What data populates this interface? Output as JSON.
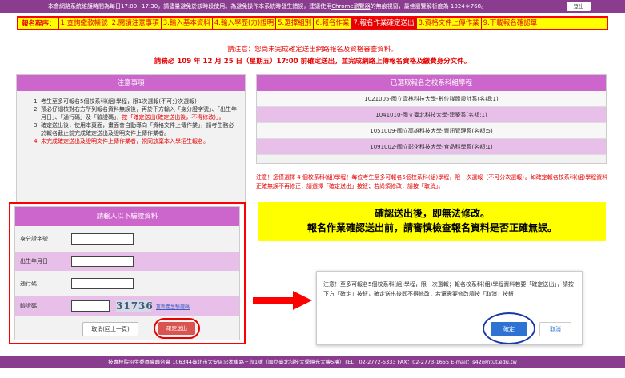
{
  "topbar": {
    "notice_part1": "本會網路系統維護時間為每日17:00~17:30，請儘量避免於該時段使用。為避免操作本系統時發生錯誤，建議使用",
    "notice_link": "Chrome瀏覽器",
    "notice_part2": "的無痕視窗，最佳瀏覽解析度為 1024＊768。",
    "logout_label": "登出"
  },
  "steps": {
    "label": "報名程序：",
    "items": [
      "1.查詢繳款帳號",
      "2.閱讀注意事項",
      "3.輸入基本資料",
      "4.輸入學歷(力)證明",
      "5.選擇組別",
      "6.報名作業",
      "7.報名作業確定送出",
      "8.資格文件上傳作業",
      "9.下載報名確認單"
    ],
    "active_index": 6
  },
  "warnings": {
    "line1": "請注意：您尚未完成確定送出網路報名及資格審查資料。",
    "line2": "請務必 109 年 12 月 25 日（星期五）17:00 前確定送出，並完成網路上傳報名資格及繳費身分文件。"
  },
  "notes": {
    "title": "注意事項",
    "items": [
      "考生至多可報名5個校系科(組)學程，限1次選報(不可分次選報)",
      "預必仔細核對右方所列報名資料無誤後，再於下方輸入「身分證字號」、「出生年月日」、「通行碼」及「驗證碼」，",
      "確定送出後，使用本頁面，畫面會自動導向「資格文件上傳作業」，請考生務必於報名截止前完成確定送出及證明文件上傳作業者。",
      "未完成確定送出及證明文件上傳作業者，視同放棄本入學招生報名。"
    ],
    "item2_red": "按「確定送出(確定送出後，不得修改)」。"
  },
  "schools": {
    "title": "已選取報名之校系科組學程",
    "rows": [
      "1021005-國立雲林科技大學-數位媒體設計系(名額:1)",
      "1041010-國立臺北科技大學-建築系(名額:1)",
      "1051009-國立高雄科技大學-資訊管理系(名額:5)",
      "1091002-國立彰化科技大學-食品科學系(名額:1)"
    ]
  },
  "bignote": "注意！您僅選擇 4 個校系科(組)學程！每位考生至多可報名5個校系科(組)學程，限一次選報（不可分次選報）。如確定報名校系科(組)學程資料正確無誤不再修正，請選擇「確定送出」按鈕；若尚須修改，請按「取消」。",
  "yellowbox": {
    "line1": "確認送出後，即無法修改。",
    "line2": "報名作業確認送出前，請審慎檢查報名資料是否正確無誤。"
  },
  "verify": {
    "title": "請輸入以下驗證資料",
    "fields": [
      {
        "label": "身分證字號"
      },
      {
        "label": "出生年月日"
      },
      {
        "label": "通行碼"
      },
      {
        "label": "驗證碼"
      }
    ],
    "captcha": "31736",
    "refresh_label": "重新產生驗證碼",
    "back_label": "取消(回上一頁)",
    "submit_label": "確定送出"
  },
  "dialog": {
    "message": "注意！至多可報名5個校系科(組)學程，限一次選報；報名校系科(組)學程資料若要「確定送出」，請按下方「確定」按鈕，確定送出後即不得修改，若還需要修改請按「取消」按鈕",
    "ok_label": "確定",
    "cancel_label": "取消"
  },
  "footer": "技專校院招生委員會聯合會 106344臺北市大安區忠孝東路三段1號（國立臺北科技大學億光大樓5樓）TEL：02-2772-5333 FAX：02-2773-1655 E-mail：s42@ntut.edu.tw",
  "colors": {
    "purple": "#8a3d8f",
    "panel_head": "#cc66cc",
    "highlight_red": "#e60000",
    "yellow": "#ffff00",
    "ok_blue": "#2e73d4"
  }
}
